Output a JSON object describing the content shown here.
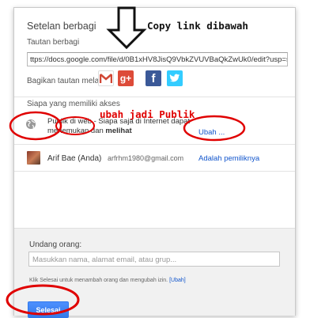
{
  "dialog": {
    "title": "Setelan berbagi",
    "close_glyph": "×"
  },
  "annotations": {
    "copy_link": "Copy link dibawah",
    "make_public": "ubah jadi Publik"
  },
  "link_section": {
    "label": "Tautan berbagi",
    "url": "ttps://docs.google.com/file/d/0B1xHV8JisQ9VbkZVUVBaQkZwUk0/edit?usp=sharing",
    "share_via_label": "Bagikan tautan melalui:",
    "share_icons": [
      {
        "name": "gmail-icon",
        "glyph": "M",
        "color": "#d14836"
      },
      {
        "name": "google-plus-icon",
        "glyph": "g+",
        "color": "#dd4b39"
      },
      {
        "name": "facebook-icon",
        "glyph": "f",
        "color": "#3b5998"
      },
      {
        "name": "twitter-icon",
        "glyph": "t",
        "color": "#33ccff"
      }
    ]
  },
  "access": {
    "label": "Siapa yang memiliki akses",
    "public_row": {
      "line1": "Publik di web - Siapa saja di Internet dapat",
      "line2_prefix": "menemukan dan ",
      "line2_bold": "melihat",
      "action": "Ubah ..."
    },
    "owner_row": {
      "name": "Arif Bae (Anda)",
      "email": "arfrhm1980@gmail.com",
      "role": "Adalah pemiliknya"
    }
  },
  "invite": {
    "label": "Undang orang:",
    "placeholder": "Masukkan nama, alamat email, atau grup...",
    "hint": "Klik Selesai untuk menambah orang dan mengubah izin.",
    "hint_link": "[Ubah]"
  },
  "done_button": "Selesai",
  "colors": {
    "primary_button": "#4d90fe",
    "link": "#1155cc",
    "annotation_red": "#e00000"
  }
}
